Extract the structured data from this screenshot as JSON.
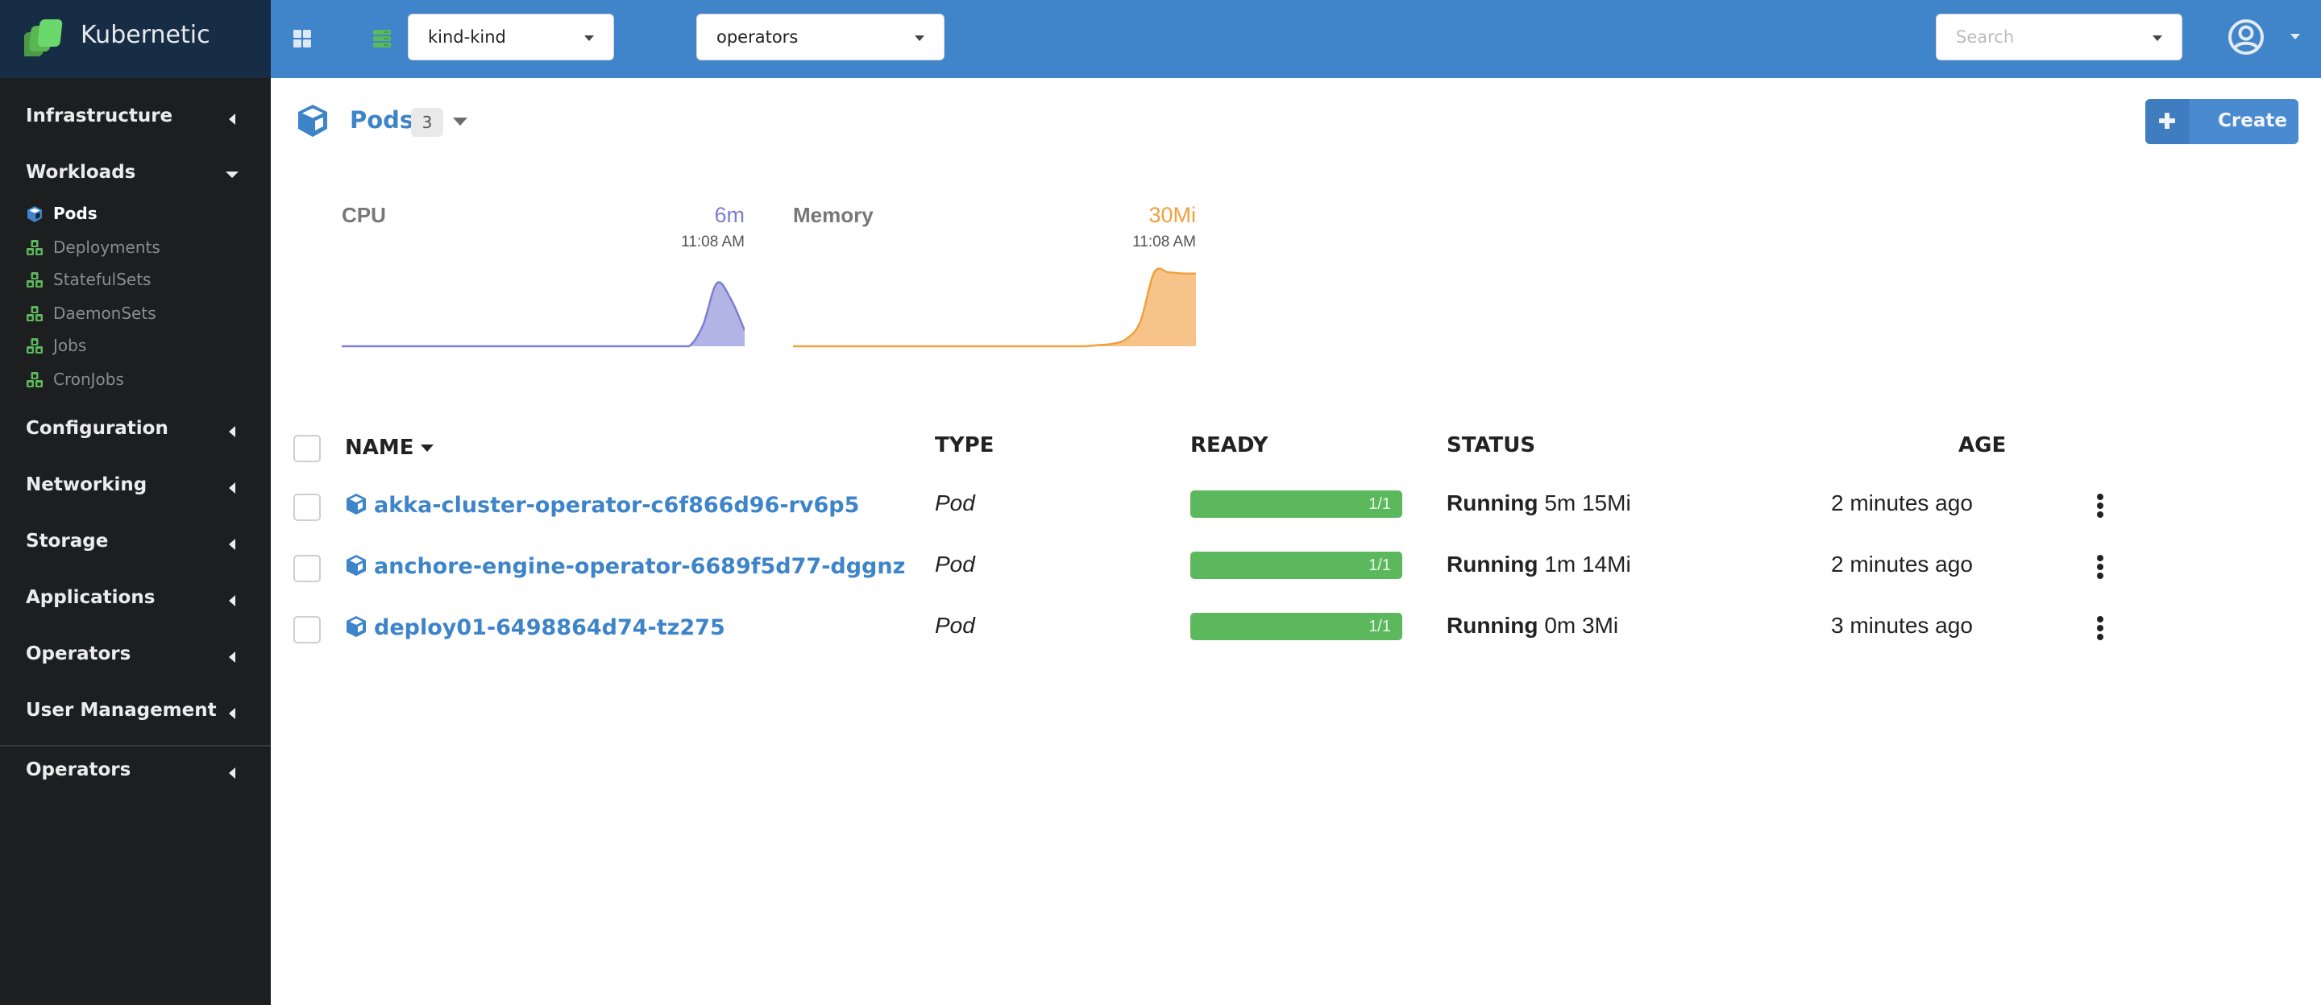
{
  "app": {
    "name": "Kubernetic"
  },
  "header": {
    "cluster_select": {
      "value": "kind-kind"
    },
    "namespace_select": {
      "value": "operators"
    },
    "search": {
      "placeholder": "Search",
      "value": ""
    },
    "icons": {
      "layout": "grid-icon",
      "cluster": "server-stack-icon",
      "user": "user-circle-icon"
    }
  },
  "sidebar": {
    "sections": [
      {
        "label": "Infrastructure",
        "expanded": false
      },
      {
        "label": "Workloads",
        "expanded": true
      },
      {
        "label": "Configuration",
        "expanded": false
      },
      {
        "label": "Networking",
        "expanded": false
      },
      {
        "label": "Storage",
        "expanded": false
      },
      {
        "label": "Applications",
        "expanded": false
      },
      {
        "label": "Operators",
        "expanded": false
      },
      {
        "label": "User Management",
        "expanded": false
      },
      {
        "label": "Operators",
        "expanded": false
      }
    ],
    "workloads_items": [
      {
        "label": "Pods",
        "icon": "cube-icon",
        "active": true
      },
      {
        "label": "Deployments",
        "icon": "cubes-icon",
        "active": false
      },
      {
        "label": "StatefulSets",
        "icon": "cubes-icon",
        "active": false
      },
      {
        "label": "DaemonSets",
        "icon": "cubes-icon",
        "active": false
      },
      {
        "label": "Jobs",
        "icon": "cubes-icon",
        "active": false
      },
      {
        "label": "CronJobs",
        "icon": "cubes-icon",
        "active": false
      }
    ]
  },
  "page": {
    "title": "Pods",
    "count": "3",
    "create_label": "Create"
  },
  "metrics": {
    "cpu": {
      "title": "CPU",
      "value": "6m",
      "time": "11:08 AM",
      "color": "#7b7fcf",
      "fill": "#b3b4e6"
    },
    "memory": {
      "title": "Memory",
      "value": "30Mi",
      "time": "11:08 AM",
      "color": "#f0a03c",
      "fill": "#f6c489"
    }
  },
  "chart_data": [
    {
      "type": "area",
      "title": "CPU",
      "current_label": "6m",
      "time_label": "11:08 AM",
      "x": [
        0,
        1,
        2,
        3,
        4,
        5,
        6,
        7,
        8,
        9,
        10,
        11,
        12,
        13,
        14,
        15,
        16,
        17,
        18,
        19,
        20,
        21,
        22,
        23,
        24,
        25,
        26,
        27,
        28,
        29
      ],
      "values": [
        0,
        0,
        0,
        0,
        0,
        0,
        0,
        0,
        0,
        0,
        0,
        0,
        0,
        0,
        0,
        0,
        0,
        0,
        0,
        0,
        0,
        0,
        0,
        0,
        0,
        0,
        2,
        6,
        4.5,
        1.5
      ],
      "ylim": [
        0,
        7.5
      ],
      "grid": false
    },
    {
      "type": "area",
      "title": "Memory",
      "current_label": "30Mi",
      "time_label": "11:08 AM",
      "x": [
        0,
        1,
        2,
        3,
        4,
        5,
        6,
        7,
        8,
        9,
        10,
        11,
        12,
        13,
        14,
        15,
        16,
        17,
        18,
        19,
        20,
        21,
        22,
        23,
        24,
        25,
        26,
        27,
        28,
        29
      ],
      "values": [
        0,
        0,
        0,
        0,
        0,
        0,
        0,
        0,
        0,
        0,
        0,
        0,
        0,
        0,
        0,
        0,
        0,
        0,
        0,
        0,
        0,
        0,
        0.5,
        1,
        3,
        10,
        30,
        30,
        29.5,
        29.5
      ],
      "ylim": [
        0,
        32
      ],
      "grid": false
    }
  ],
  "table": {
    "columns": [
      "NAME",
      "TYPE",
      "READY",
      "STATUS",
      "AGE"
    ],
    "sort_column": "NAME",
    "rows": [
      {
        "name": "akka-cluster-operator-c6f866d96-rv6p5",
        "type": "Pod",
        "ready": "1/1",
        "ready_fraction": 1.0,
        "status": "Running",
        "status_detail": "5m 15Mi",
        "age": "2 minutes ago"
      },
      {
        "name": "anchore-engine-operator-6689f5d77-dggnz",
        "type": "Pod",
        "ready": "1/1",
        "ready_fraction": 1.0,
        "status": "Running",
        "status_detail": "1m 14Mi",
        "age": "2 minutes ago"
      },
      {
        "name": "deploy01-6498864d74-tz275",
        "type": "Pod",
        "ready": "1/1",
        "ready_fraction": 1.0,
        "status": "Running",
        "status_detail": "0m 3Mi",
        "age": "3 minutes ago"
      }
    ]
  },
  "colors": {
    "header_bg": "#4084c9",
    "brand_bg": "#172d45",
    "sidebar_bg": "#1d1e20",
    "link": "#3d84c9",
    "ready_green": "#5cb85c",
    "accent_green": "#5cb85c"
  }
}
